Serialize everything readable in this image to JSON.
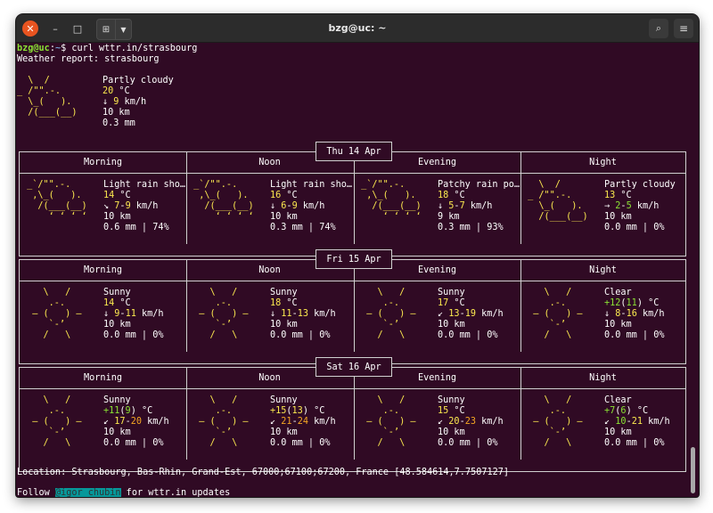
{
  "window": {
    "title": "bzg@uc: ~"
  },
  "prompt": {
    "user": "bzg@uc",
    "sep": ":",
    "path": "~",
    "sym": "$ ",
    "command": "curl wttr.in/strasbourg"
  },
  "report_title": "Weather report: strasbourg",
  "current": {
    "art": [
      "  \\  /       ",
      "_ /\"\".-.     ",
      "  \\_(   ).   ",
      "  /(___(__)  "
    ],
    "condition": "Partly cloudy",
    "temp": "20",
    "temp_unit": " °C",
    "wind_dir": "↓",
    "wind": "9",
    "wind_unit": " km/h",
    "visibility": "10 km",
    "precip": "0.3 mm"
  },
  "columns": [
    "Morning",
    "Noon",
    "Evening",
    "Night"
  ],
  "days": [
    {
      "date": "Thu 14 Apr",
      "cells": [
        {
          "art": [
            " _`/\"\".-.",
            "  ,\\_(   ).",
            "   /(___(__)",
            "     ʻ ʻ ʻ ʻ"
          ],
          "cond": "Light rain sho…",
          "temp": [
            {
              "t": "14",
              "c": "y"
            }
          ],
          "dir": "↘",
          "wind": [
            {
              "t": "7",
              "c": "y"
            },
            {
              "t": "-",
              "c": "w"
            },
            {
              "t": "9",
              "c": "y"
            }
          ],
          "vis": "10 km",
          "precip": "0.6 mm | 74%"
        },
        {
          "art": [
            " _`/\"\".-.",
            "  ,\\_(   ).",
            "   /(___(__)",
            "     ʻ ʻ ʻ ʻ"
          ],
          "cond": "Light rain sho…",
          "temp": [
            {
              "t": "16",
              "c": "y"
            }
          ],
          "dir": "↓",
          "wind": [
            {
              "t": "6",
              "c": "y"
            },
            {
              "t": "-",
              "c": "w"
            },
            {
              "t": "9",
              "c": "y"
            }
          ],
          "vis": "10 km",
          "precip": "0.3 mm | 74%"
        },
        {
          "art": [
            " _`/\"\".-.",
            "  ,\\_(   ).",
            "   /(___(__)",
            "     ʻ ʻ ʻ ʻ"
          ],
          "cond": "Patchy rain po…",
          "temp": [
            {
              "t": "18",
              "c": "y"
            }
          ],
          "dir": "↓",
          "wind": [
            {
              "t": "5",
              "c": "y"
            },
            {
              "t": "-",
              "c": "w"
            },
            {
              "t": "7",
              "c": "y"
            }
          ],
          "vis": "9 km",
          "precip": "0.3 mm | 93%"
        },
        {
          "art": [
            "   \\  /",
            " _ /\"\".-.",
            "   \\_(   ).",
            "   /(___(__)"
          ],
          "cond": "Partly cloudy",
          "temp": [
            {
              "t": "13",
              "c": "y"
            }
          ],
          "dir": "→",
          "wind": [
            {
              "t": "2",
              "c": "g"
            },
            {
              "t": "-",
              "c": "w"
            },
            {
              "t": "5",
              "c": "g"
            }
          ],
          "vis": "10 km",
          "precip": "0.0 mm | 0%"
        }
      ]
    },
    {
      "date": "Fri 15 Apr",
      "cells": [
        {
          "art": [
            "    \\   /",
            "     .-.",
            "  ‒ (   ) ‒",
            "     `-’",
            "    /   \\"
          ],
          "cond": "Sunny",
          "temp": [
            {
              "t": "14",
              "c": "y"
            }
          ],
          "dir": "↓",
          "wind": [
            {
              "t": "9",
              "c": "y"
            },
            {
              "t": "-",
              "c": "w"
            },
            {
              "t": "11",
              "c": "y"
            }
          ],
          "vis": "10 km",
          "precip": "0.0 mm | 0%"
        },
        {
          "art": [
            "    \\   /",
            "     .-.",
            "  ‒ (   ) ‒",
            "     `-’",
            "    /   \\"
          ],
          "cond": "Sunny",
          "temp": [
            {
              "t": "18",
              "c": "y"
            }
          ],
          "dir": "↓",
          "wind": [
            {
              "t": "11",
              "c": "y"
            },
            {
              "t": "-",
              "c": "w"
            },
            {
              "t": "13",
              "c": "y"
            }
          ],
          "vis": "10 km",
          "precip": "0.0 mm | 0%"
        },
        {
          "art": [
            "    \\   /",
            "     .-.",
            "  ‒ (   ) ‒",
            "     `-’",
            "    /   \\"
          ],
          "cond": "Sunny",
          "temp": [
            {
              "t": "17",
              "c": "y"
            }
          ],
          "dir": "↙",
          "wind": [
            {
              "t": "13",
              "c": "y"
            },
            {
              "t": "-",
              "c": "w"
            },
            {
              "t": "19",
              "c": "y"
            }
          ],
          "vis": "10 km",
          "precip": "0.0 mm | 0%"
        },
        {
          "art": [
            "    \\   /",
            "     .-.",
            "  ‒ (   ) ‒",
            "     `-’",
            "    /   \\"
          ],
          "cond": "Clear",
          "temp": [
            {
              "t": "+12",
              "c": "g"
            },
            {
              "t": "(",
              "c": "w"
            },
            {
              "t": "11",
              "c": "g"
            },
            {
              "t": ")",
              "c": "w"
            }
          ],
          "dir": "↓",
          "wind": [
            {
              "t": "8",
              "c": "y"
            },
            {
              "t": "-",
              "c": "w"
            },
            {
              "t": "16",
              "c": "y"
            }
          ],
          "vis": "10 km",
          "precip": "0.0 mm | 0%"
        }
      ]
    },
    {
      "date": "Sat 16 Apr",
      "cells": [
        {
          "art": [
            "    \\   /",
            "     .-.",
            "  ‒ (   ) ‒",
            "     `-’",
            "    /   \\"
          ],
          "cond": "Sunny",
          "temp": [
            {
              "t": "+11",
              "c": "g"
            },
            {
              "t": "(",
              "c": "w"
            },
            {
              "t": "9",
              "c": "g"
            },
            {
              "t": ")",
              "c": "w"
            }
          ],
          "dir": "↙",
          "wind": [
            {
              "t": "17",
              "c": "y"
            },
            {
              "t": "-",
              "c": "w"
            },
            {
              "t": "20",
              "c": "o"
            }
          ],
          "vis": "10 km",
          "precip": "0.0 mm | 0%"
        },
        {
          "art": [
            "    \\   /",
            "     .-.",
            "  ‒ (   ) ‒",
            "     `-’",
            "    /   \\"
          ],
          "cond": "Sunny",
          "temp": [
            {
              "t": "+15",
              "c": "y"
            },
            {
              "t": "(",
              "c": "w"
            },
            {
              "t": "13",
              "c": "y"
            },
            {
              "t": ")",
              "c": "w"
            }
          ],
          "dir": "↙",
          "wind": [
            {
              "t": "21",
              "c": "o"
            },
            {
              "t": "-",
              "c": "w"
            },
            {
              "t": "24",
              "c": "o"
            }
          ],
          "vis": "10 km",
          "precip": "0.0 mm | 0%"
        },
        {
          "art": [
            "    \\   /",
            "     .-.",
            "  ‒ (   ) ‒",
            "     `-’",
            "    /   \\"
          ],
          "cond": "Sunny",
          "temp": [
            {
              "t": "15",
              "c": "y"
            }
          ],
          "dir": "↙",
          "wind": [
            {
              "t": "20",
              "c": "y"
            },
            {
              "t": "-",
              "c": "w"
            },
            {
              "t": "23",
              "c": "o"
            }
          ],
          "vis": "10 km",
          "precip": "0.0 mm | 0%"
        },
        {
          "art": [
            "    \\   /",
            "     .-.",
            "  ‒ (   ) ‒",
            "     `-’",
            "    /   \\"
          ],
          "cond": "Clear",
          "temp": [
            {
              "t": "+7",
              "c": "g"
            },
            {
              "t": "(",
              "c": "w"
            },
            {
              "t": "6",
              "c": "g"
            },
            {
              "t": ")",
              "c": "w"
            }
          ],
          "dir": "↙",
          "wind": [
            {
              "t": "10",
              "c": "g"
            },
            {
              "t": "-",
              "c": "w"
            },
            {
              "t": "21",
              "c": "y"
            }
          ],
          "vis": "10 km",
          "precip": "0.0 mm | 0%"
        }
      ]
    }
  ],
  "location": "Location: Strasbourg, Bas-Rhin, Grand-Est, 67000;67100;67200, France [48.584614,7.7507127]",
  "follow": {
    "pre": "Follow ",
    "handle": "@igor_chubin",
    "post": " for wttr.in updates"
  },
  "colors": {
    "background": "#300a24",
    "accent": "#e95420",
    "green": "#8ae234",
    "yellow": "#fce94f",
    "orange": "#f5a623"
  },
  "icons": {
    "close": "close-icon",
    "minimize": "minimize-icon",
    "maximize": "maximize-icon",
    "new_tab": "new-tab-icon",
    "search": "search-icon",
    "menu": "hamburger-menu-icon"
  }
}
